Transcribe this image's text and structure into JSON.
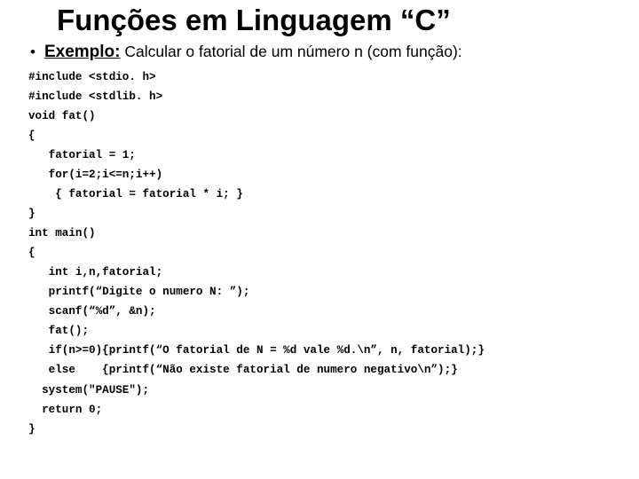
{
  "title": "Funções em Linguagem “C”",
  "bullet": {
    "label": "Exemplo:",
    "text": " Calcular o fatorial de um número n (com função):"
  },
  "code": {
    "l01": "#include <stdio. h>",
    "l02": "#include <stdlib. h>",
    "l03": "void fat()",
    "l04": "{",
    "l05": "   fatorial = 1;",
    "l06": "   for(i=2;i<=n;i++)",
    "l07": "    { fatorial = fatorial * i; }",
    "l08": "}",
    "l09": "int main()",
    "l10": "{",
    "l11": "   int i,n,fatorial;",
    "l12": "   printf(“Digite o numero N: ”);",
    "l13": "   scanf(“%d”, &n);",
    "l14": "   fat();",
    "l15": "   if(n>=0){printf(“O fatorial de N = %d vale %d.\\n”, n, fatorial);}",
    "l16": "   else    {printf(“Não existe fatorial de numero negativo\\n”);}",
    "l17": "  system(\"PAUSE\");",
    "l18": "  return 0;",
    "l19": "}"
  }
}
